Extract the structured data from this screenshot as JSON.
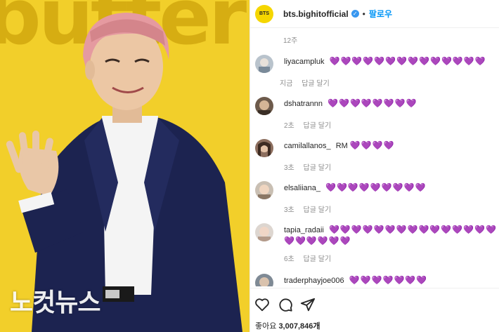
{
  "photo": {
    "watermark": "노컷뉴스",
    "background_color": "#f2cf2a"
  },
  "header": {
    "logo_text": "BTS",
    "username": "bts.bighitofficial",
    "verified_icon": "verified-badge-icon",
    "separator": "•",
    "follow_label": "팔로우"
  },
  "post": {
    "time_ago": "12주"
  },
  "comments": [
    {
      "user": "liyacampluk",
      "text": "",
      "hearts": "💜💜💜💜💜💜💜💜💜💜💜💜💜💜",
      "time": "지금",
      "reply": "답글 달기"
    },
    {
      "user": "dshatrannn",
      "text": "",
      "hearts": "💜💜💜💜💜💜💜💜",
      "time": "2초",
      "reply": "답글 달기"
    },
    {
      "user": "camilallanos_",
      "text": "RM",
      "hearts": "💜💜💜💜",
      "time": "3초",
      "reply": "답글 달기"
    },
    {
      "user": "elsaliiana_",
      "text": "",
      "hearts": "💜💜💜💜💜💜💜💜💜",
      "time": "3초",
      "reply": "답글 달기"
    },
    {
      "user": "tapia_radaii",
      "text": "",
      "hearts": "💜💜💜💜💜💜💜💜💜💜💜💜💜💜💜💜💜💜💜💜💜",
      "time": "6초",
      "reply": "답글 달기"
    },
    {
      "user": "traderphayjoe006",
      "text": "",
      "hearts": "💜💜💜💜💜💜💜",
      "time": "",
      "reply": ""
    }
  ],
  "actions": {
    "like_icon": "heart-outline-icon",
    "comment_icon": "comment-icon",
    "share_icon": "share-icon",
    "likes_label": "좋아요",
    "likes_count": "3,007,846개"
  },
  "colors": {
    "heart_purple": "#7b4fd6",
    "link_blue": "#0095f6",
    "meta_gray": "#8e8e8e"
  }
}
